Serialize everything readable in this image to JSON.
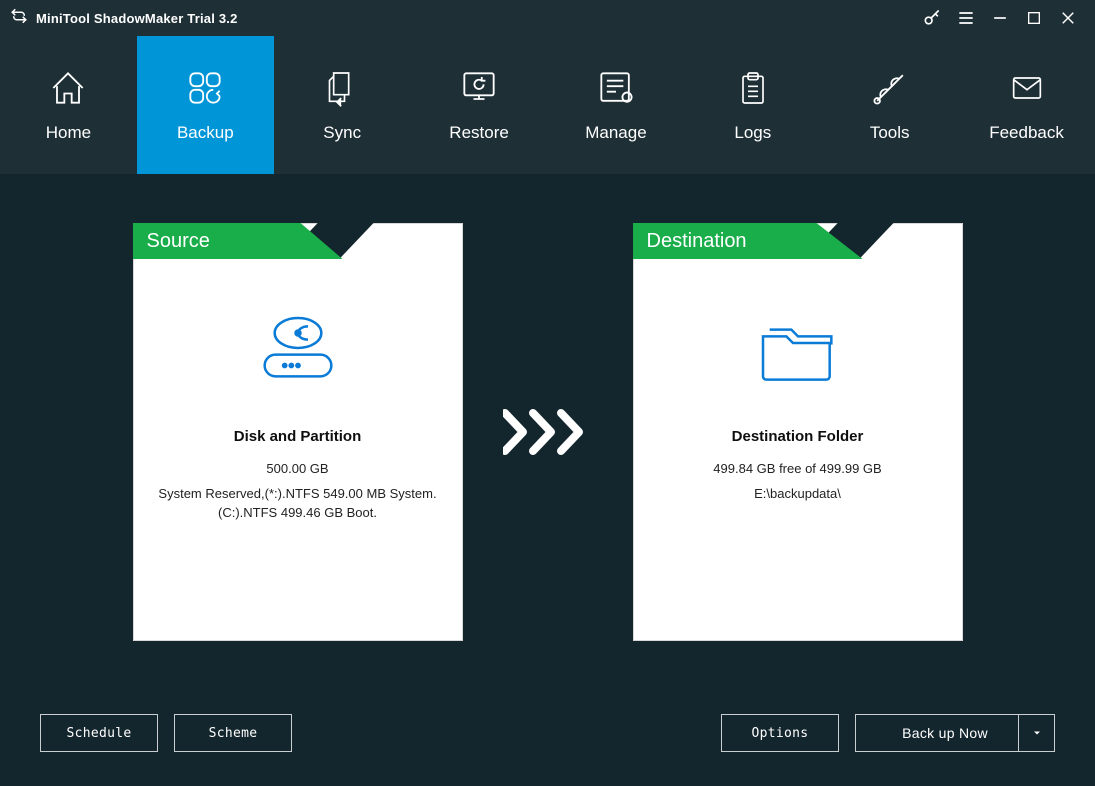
{
  "app": {
    "title": "MiniTool ShadowMaker Trial 3.2"
  },
  "nav": {
    "items": [
      {
        "label": "Home"
      },
      {
        "label": "Backup"
      },
      {
        "label": "Sync"
      },
      {
        "label": "Restore"
      },
      {
        "label": "Manage"
      },
      {
        "label": "Logs"
      },
      {
        "label": "Tools"
      },
      {
        "label": "Feedback"
      }
    ]
  },
  "source": {
    "header": "Source",
    "title": "Disk and Partition",
    "capacity": "500.00 GB",
    "detail1": "System Reserved,(*:).NTFS 549.00 MB System.",
    "detail2": "(C:).NTFS 499.46 GB Boot."
  },
  "destination": {
    "header": "Destination",
    "title": "Destination Folder",
    "free": "499.84 GB free of 499.99 GB",
    "path": "E:\\backupdata\\"
  },
  "buttons": {
    "schedule": "Schedule",
    "scheme": "Scheme",
    "options": "Options",
    "backup_now": "Back up Now"
  }
}
